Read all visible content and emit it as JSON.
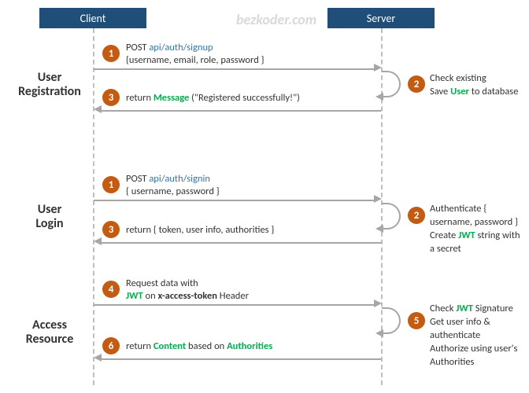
{
  "watermark": "bezkoder.com",
  "lifelines": {
    "client": "Client",
    "server": "Server"
  },
  "sections": {
    "reg": {
      "label_l1": "User",
      "label_l2": "Registration"
    },
    "login": {
      "label_l1": "User",
      "label_l2": "Login"
    },
    "access": {
      "label_l1": "Access",
      "label_l2": "Resource"
    }
  },
  "steps": {
    "reg1": {
      "num": "1",
      "prefix": "POST ",
      "endpoint": "api/auth/signup",
      "body": "{username, email, role, password }"
    },
    "reg2": {
      "num": "2",
      "line1_pre": "Check existing",
      "line2_pre": "Save ",
      "line2_kw": "User",
      "line2_post": " to database"
    },
    "reg3": {
      "num": "3",
      "pre": "return ",
      "kw": "Message",
      "post": " (\"Registered successfully!\")"
    },
    "login1": {
      "num": "1",
      "prefix": "POST ",
      "endpoint": "api/auth/signin",
      "body": "{ username, password }"
    },
    "login2": {
      "num": "2",
      "line1": "Authenticate { username, password }",
      "line2_pre": "Create ",
      "line2_kw": "JWT",
      "line2_post": " string with a secret"
    },
    "login3": {
      "num": "3",
      "text": "return { token, user info, authorities }"
    },
    "acc4": {
      "num": "4",
      "line1": "Request  data with",
      "kw": "JWT",
      "mid": " on ",
      "strong": "x-access-token",
      "tail": " Header"
    },
    "acc5": {
      "num": "5",
      "l1_pre": "Check ",
      "l1_kw": "JWT",
      "l1_post": " Signature",
      "l2": "Get user info & authenticate",
      "l3": "Authorize using user's Authorities"
    },
    "acc6": {
      "num": "6",
      "pre": "return ",
      "kw1": "Content",
      "mid": " based on ",
      "kw2": "Authorities"
    }
  }
}
